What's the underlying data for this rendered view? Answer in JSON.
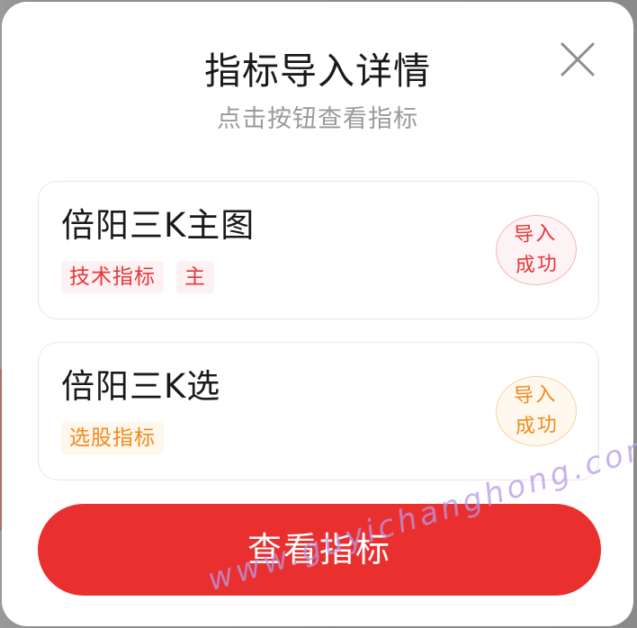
{
  "dialog": {
    "title": "指标导入详情",
    "subtitle": "点击按钮查看指标",
    "close_icon": "close-icon"
  },
  "indicators": [
    {
      "name": "倍阳三K主图",
      "tags": [
        "技术指标",
        "主"
      ],
      "status_line1": "导入",
      "status_line2": "成功",
      "accent": "#e8363a"
    },
    {
      "name": "倍阳三K选",
      "tags": [
        "选股指标"
      ],
      "status_line1": "导入",
      "status_line2": "成功",
      "accent": "#f08a1c"
    }
  ],
  "cta": {
    "label": "查看指标",
    "color": "#ea2f2f"
  },
  "watermark": {
    "text": "www.guyichanghong.com"
  }
}
